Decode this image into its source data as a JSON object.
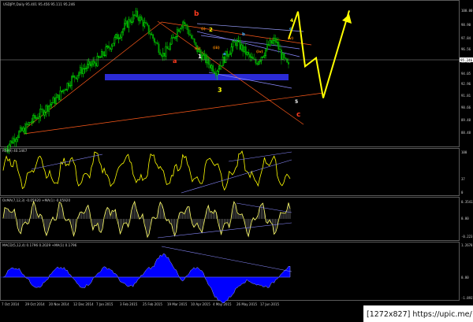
{
  "header": {
    "symbol_line": "USDJPY,Daily  95.401 95.456 95.111 95.246"
  },
  "panels": {
    "rsi_label": "RSI(9) 40.1467",
    "osma_label": "OsMA(7,12,3) -0.05920  +MA(1) -0.05920",
    "macd_label": "MACD(5,12,4) 0.1796 0.2029  +MA(1) 0.1796"
  },
  "price_axis": [
    "100.00",
    "98.90",
    "97.84",
    "96.56",
    "95.48",
    "94.05",
    "92.96",
    "91.81",
    "90.66",
    "89.48",
    "88.48"
  ],
  "rsi_axis": [
    "100",
    "37",
    "0"
  ],
  "osma_axis": [
    "0.35413",
    "0.00",
    "-0.22312"
  ],
  "macd_axis": [
    "1.2678",
    "0.00",
    "-1.8937"
  ],
  "time_axis": [
    "7 Oct 2014",
    "29 Oct 2014",
    "20 Nov 2014",
    "12 Dec 2014",
    "7 Jan 2015",
    "3 Feb 2015",
    "25 Feb 2015",
    "19 Mar 2015",
    "10 Apr 2015",
    "4 May 2015",
    "26 May 2015",
    "17 Jun 2015"
  ],
  "wave_labels": [
    {
      "t": "a",
      "c": "#ff3b1f"
    },
    {
      "t": "b",
      "c": "#ff3b1f"
    },
    {
      "t": "c",
      "c": "#ff3b1f"
    },
    {
      "t": "1",
      "c": "#ffffff"
    },
    {
      "t": "2",
      "c": "#ffff00"
    },
    {
      "t": "3",
      "c": "#ffff00"
    },
    {
      "t": "4",
      "c": "#ffff00"
    },
    {
      "t": "5",
      "c": "#ffffff"
    },
    {
      "t": "a",
      "c": "#3ab0ff"
    },
    {
      "t": "b",
      "c": "#3ab0ff"
    },
    {
      "t": "c",
      "c": "#3ab0ff"
    },
    {
      "t": "(i)",
      "c": "#ff8c00"
    },
    {
      "t": "(ii)",
      "c": "#ff8c00"
    },
    {
      "t": "(iii)",
      "c": "#ff8c00"
    },
    {
      "t": "(iv)",
      "c": "#ff8c00"
    },
    {
      "t": "(v)",
      "c": "#ff8c00"
    }
  ],
  "current_price": "95.246",
  "watermark": "[1272x827] https://upic.me/",
  "colors": {
    "bull": "#00ff00",
    "bear": "#00a000",
    "rsi": "#ffff00",
    "osma": "#ffff66",
    "macd_fill": "#0000ff",
    "band": "#2b2bd6",
    "trend": "#ff5a1a",
    "channel": "#8a8aff",
    "arrow": "#ffff00"
  },
  "chart_data": {
    "type": "candlestick",
    "title": "USDJPY,Daily",
    "y_range": [
      88.0,
      101.0
    ],
    "x_labels": [
      "7 Oct 2014",
      "29 Oct 2014",
      "20 Nov 2014",
      "12 Dec 2014",
      "7 Jan 2015",
      "3 Feb 2015",
      "25 Feb 2015",
      "19 Mar 2015",
      "10 Apr 2015",
      "4 May 2015",
      "26 May 2015",
      "17 Jun 2015"
    ],
    "close_series": [
      87.4,
      88.2,
      88.9,
      89.3,
      90.1,
      90.6,
      91.2,
      91.8,
      92.3,
      93.2,
      94.0,
      94.6,
      95.1,
      95.4,
      95.8,
      96.5,
      97.3,
      98.1,
      98.9,
      99.7,
      100.2,
      99.4,
      98.5,
      97.4,
      96.4,
      97.2,
      98.6,
      99.6,
      98.4,
      97.0,
      96.2,
      95.5,
      94.9,
      95.8,
      96.8,
      97.6,
      97.0,
      96.2,
      95.6,
      96.4,
      97.3,
      97.8,
      96.2,
      95.2
    ],
    "projection": [
      97.9,
      100.5,
      95.3,
      96.1,
      92.3,
      100.6
    ]
  }
}
